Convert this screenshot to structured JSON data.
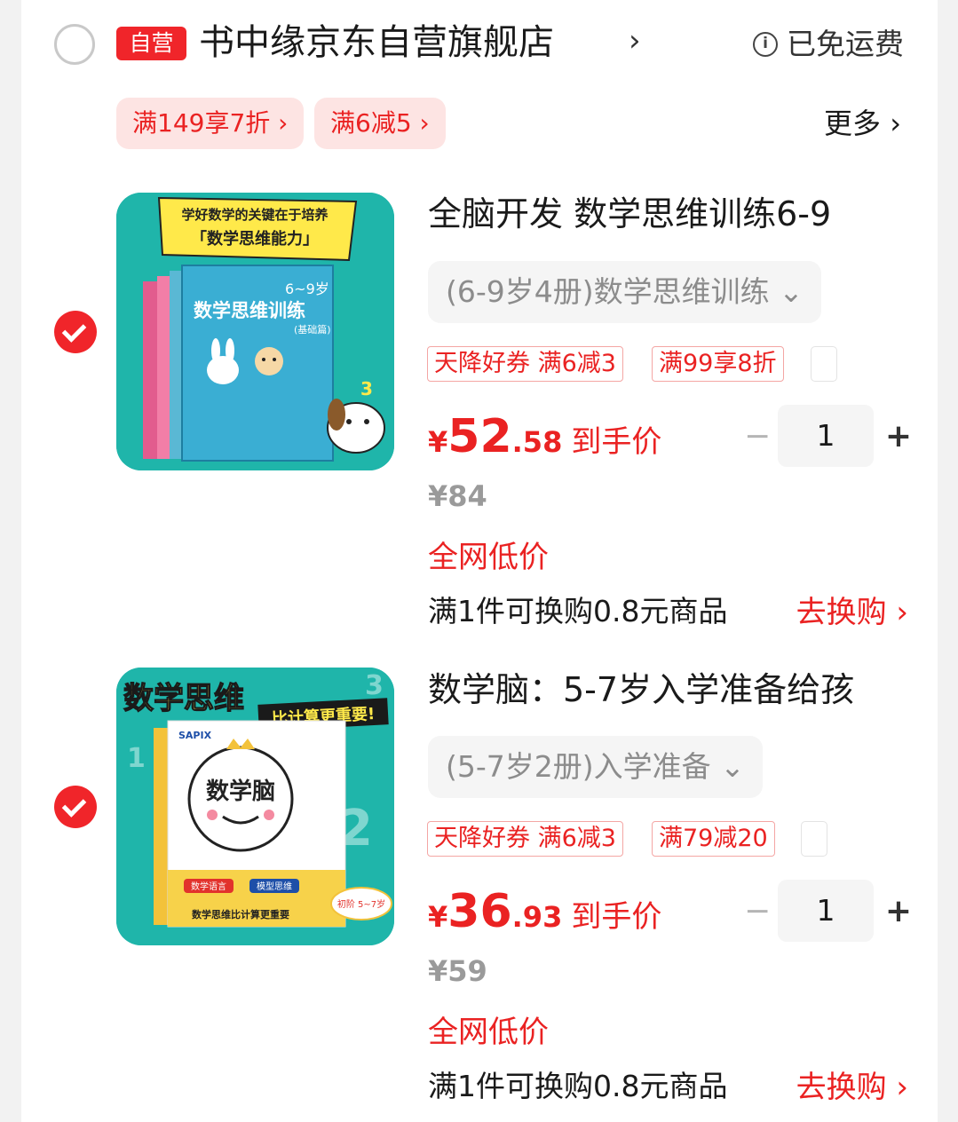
{
  "shop": {
    "self_badge": "自营",
    "name": "书中缘京东自营旗舰店",
    "chevron": "›",
    "shipping": "已免运费",
    "info_icon": "i"
  },
  "promos": [
    {
      "label": "满149享7折 ›"
    },
    {
      "label": "满6减5 ›"
    }
  ],
  "more": "更多 ›",
  "items": [
    {
      "title": "全脑开发 数学思维训练6-9",
      "variant": "(6-9岁4册)数学思维训练 ⌄",
      "tags": [
        "天降好券 满6减3",
        "满99享8折"
      ],
      "price_currency": "¥",
      "price_int": "52",
      "price_dec": ".58",
      "price_label": "到手价",
      "quantity": "1",
      "original_price": "¥84",
      "lowest": "全网低价",
      "exchange": "满1件可换购0.8元商品",
      "go_swap": "去换购 ›",
      "cover": {
        "banner_line1": "学好数学的关键在于培养",
        "banner_line2": "「数学思维能力」",
        "age": "6~9岁",
        "book_title": "数学思维训练",
        "sub": "(基础篇)"
      }
    },
    {
      "title": "数学脑：5-7岁入学准备给孩",
      "variant": "(5-7岁2册)入学准备 ⌄",
      "tags": [
        "天降好券 满6减3",
        "满79减20"
      ],
      "price_currency": "¥",
      "price_int": "36",
      "price_dec": ".93",
      "price_label": "到手价",
      "quantity": "1",
      "original_price": "¥59",
      "lowest": "全网低价",
      "exchange": "满1件可换购0.8元商品",
      "go_swap": "去换购 ›",
      "cover": {
        "headline": "数学思维",
        "subline": "比计算更重要!",
        "brand": "SAPIX",
        "book_title": "数学脑",
        "chip1": "数学语言",
        "chip2": "模型思维",
        "tagline": "数学思维比计算更重要",
        "level": "初阶 5~7岁"
      }
    }
  ],
  "stepper": {
    "minus": "−",
    "plus": "+"
  },
  "colors": {
    "accent": "#ea2222",
    "badge": "#f0252a",
    "teal": "#1fb5aa"
  }
}
